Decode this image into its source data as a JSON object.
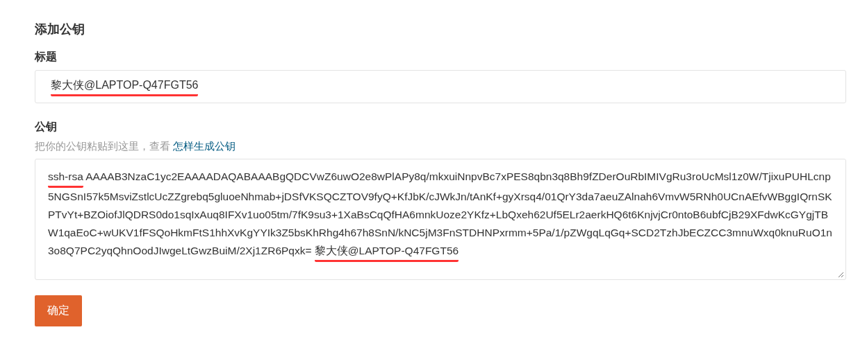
{
  "heading": "添加公钥",
  "title_field": {
    "label": "标题",
    "segments": [
      {
        "text": "黎大侠@LAPTOP-Q47FGT56",
        "marked": true
      }
    ]
  },
  "key_field": {
    "label": "公钥",
    "hint": "把你的公钥粘贴到这里，查看",
    "hint_link": "怎样生成公钥",
    "segments": [
      {
        "text": "ssh-rsa",
        "marked": true
      },
      {
        "text": " AAAAB3NzaC1yc2EAAAADAQABAAABgQDCVwZ6uwO2e8wPlAPy8q/mkxuiNnpvBc7xPES8qbn3q8Bh9fZDerOuRbIMIVgRu3roUcMsl1z0W/TjixuPUHLcnp5NGSnI57k5MsviZstlcUcZZgrebq5gluoeNhmab+jDSfVKSQCZTOV9fyQ+KfJbK/cJWkJn/tAnKf+gyXrsq4/01QrY3da7aeuZAlnah6VmvW5RNh0UCnAEfvWBggIQrnSKPTvYt+BZOiofJlQDRS0do1sqIxAuq8IFXv1uo05tm/7fK9su3+1XaBsCqQfHA6mnkUoze2YKfz+LbQxeh62Uf5ELr2aerkHQ6t6KnjvjCr0ntoB6ubfCjB29XFdwKcGYgjTBW1qaEoC+wUKV1fFSQoHkmFtS1hhXvKgYYIk3Z5bsKhRhg4h67h8SnN/kNC5jM3FnSTDHNPxrmm+5Pa/1/pZWgqLqGq+SCD2TzhJbECZCC3mnuWxq0knuRuO1n3o8Q7PC2yqQhnOodJIwgeLtGwzBuiM/2Xj1ZR6Pqxk= ",
        "marked": false
      },
      {
        "text": "黎大侠@LAPTOP-Q47FGT56",
        "marked": true
      }
    ]
  },
  "submit_button": "确定"
}
